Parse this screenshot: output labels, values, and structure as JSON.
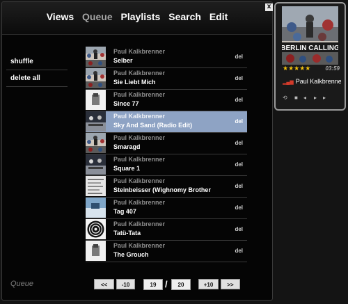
{
  "nav": {
    "items": [
      {
        "label": "Views",
        "active": false
      },
      {
        "label": "Queue",
        "active": true
      },
      {
        "label": "Playlists",
        "active": false
      },
      {
        "label": "Search",
        "active": false
      },
      {
        "label": "Edit",
        "active": false
      }
    ],
    "close_label": "x"
  },
  "sidebar": {
    "shuffle_label": "shuffle",
    "delete_all_label": "delete all"
  },
  "queue": {
    "del_label": "del",
    "selected_index": 3,
    "rows": [
      {
        "artist": "Paul Kalkbrenner",
        "title": "Selber",
        "art": "crowd"
      },
      {
        "artist": "Paul Kalkbrenner",
        "title": "Sie Liebt Mich",
        "art": "crowd"
      },
      {
        "artist": "Paul Kalkbrenner",
        "title": "Since 77",
        "art": "white"
      },
      {
        "artist": "Paul Kalkbrenner",
        "title": "Sky And Sand (Radio Edit)",
        "art": "dark"
      },
      {
        "artist": "Paul Kalkbrenner",
        "title": "Smaragd",
        "art": "crowd"
      },
      {
        "artist": "Paul Kalkbrenner",
        "title": "Square 1",
        "art": "dark"
      },
      {
        "artist": "Paul Kalkbrenner",
        "title": "Steinbeisser (Wighnomy Brother",
        "art": "text"
      },
      {
        "artist": "Paul Kalkbrenner",
        "title": "Tag 407",
        "art": "blue"
      },
      {
        "artist": "Paul Kalkbrenner",
        "title": "Tatü-Tata",
        "art": "spiral"
      },
      {
        "artist": "Paul Kalkbrenner",
        "title": "The Grouch",
        "art": "white"
      }
    ]
  },
  "footer": {
    "view_label": "Queue",
    "first_label": "<<",
    "back10_label": "-10",
    "current_page": "19",
    "separator": "/",
    "total_pages": "20",
    "fwd10_label": "+10",
    "last_label": ">>"
  },
  "player": {
    "album_title": "BERLIN CALLING",
    "rating_stars": "★★★★★",
    "rating": 5,
    "time": "03:59",
    "now_playing": "Paul Kalkbrenner",
    "colors": {
      "accent": "#8ea3c4",
      "stars": "#f2c20d",
      "eq": "#d23a2a"
    }
  }
}
